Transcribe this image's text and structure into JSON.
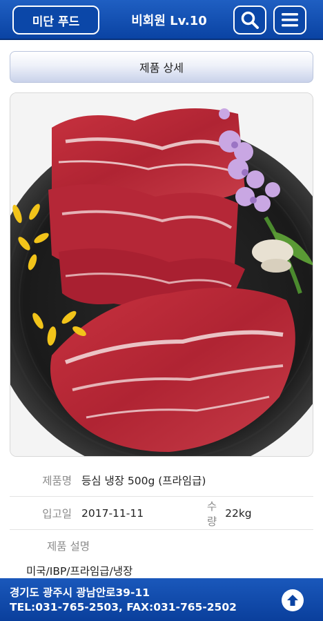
{
  "header": {
    "brand_label": "미단 푸드",
    "member_label": "비회원  Lv.10",
    "search_icon": "search-icon",
    "menu_icon": "hamburger-menu-icon",
    "color_primary": "#0a43a3"
  },
  "title_bar": {
    "label": "제품 상세"
  },
  "product": {
    "image_alt": "marbled beef on black plate with purple flowers",
    "name_label": "제품명",
    "name_value": "등심 냉장 500g (프라임급)",
    "date_label": "입고일",
    "date_value": "2017-11-11",
    "qty_label": "수량",
    "qty_value": "22kg",
    "desc_label": "제품 설명",
    "desc_value": "미국/IBP/프라임급/냉장"
  },
  "footer": {
    "address": "경기도 광주시 광남안로39-11",
    "contact": "TEL:031-765-2503, FAX:031-765-2502",
    "top_icon": "arrow-up-icon"
  }
}
